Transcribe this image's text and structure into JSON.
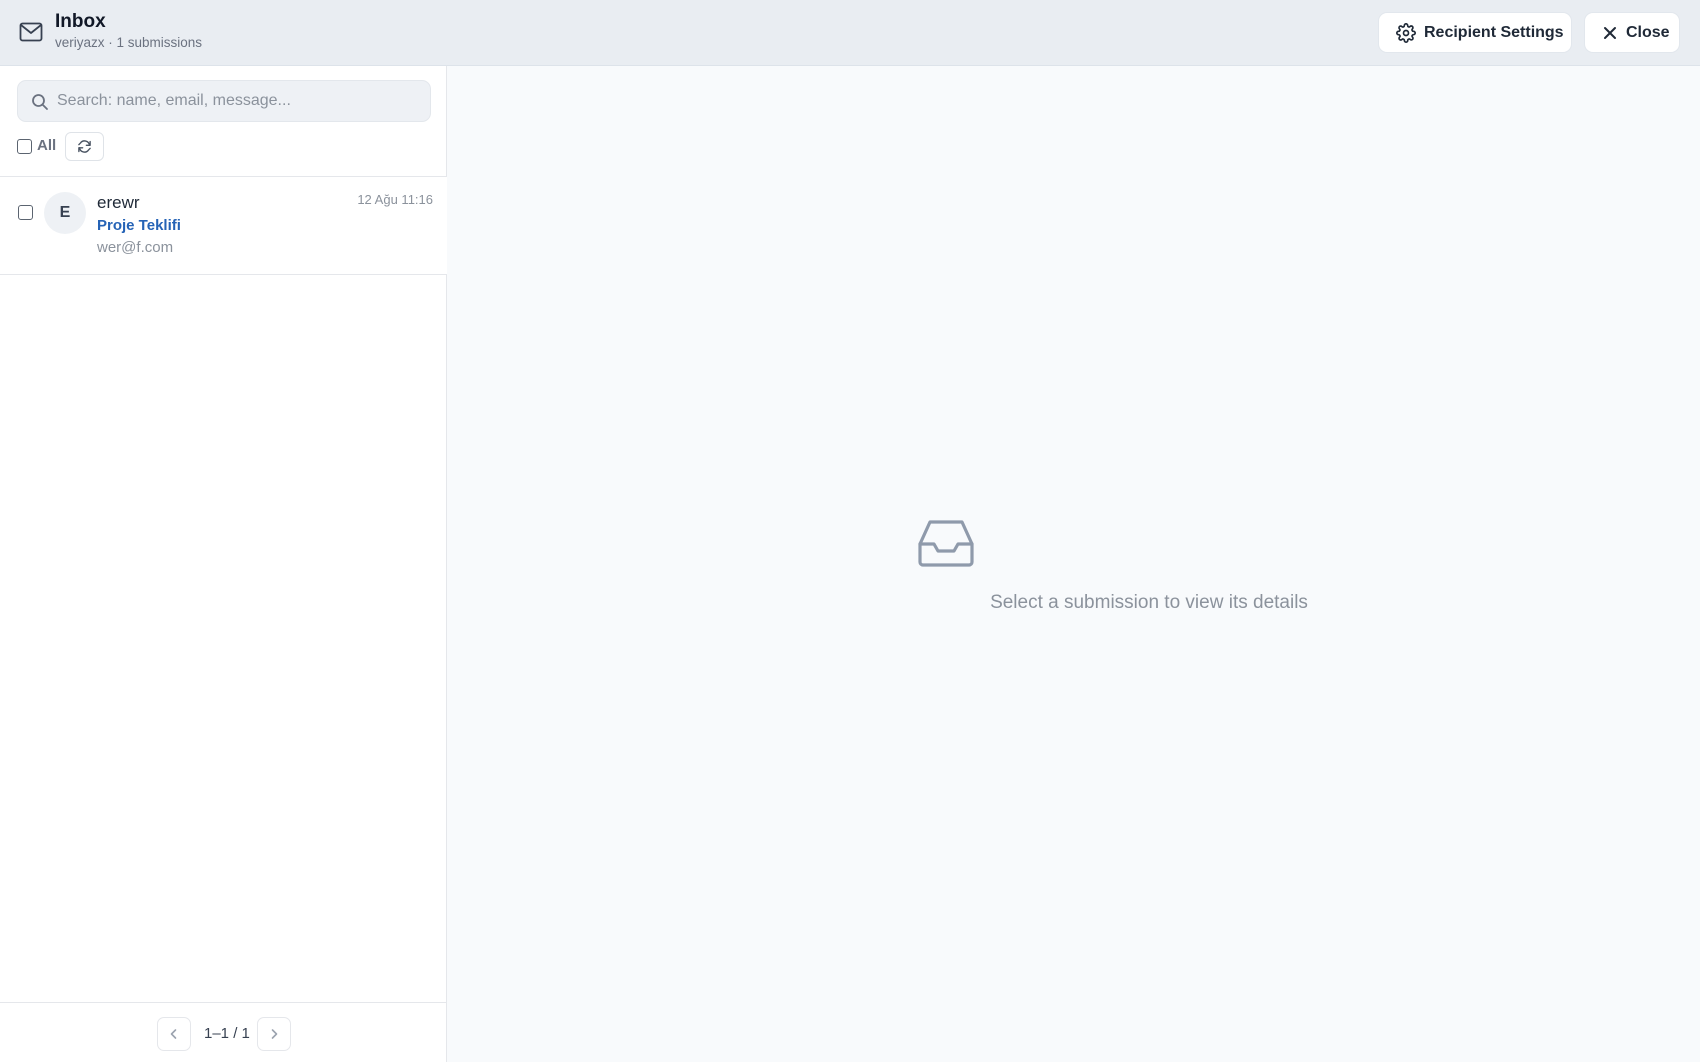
{
  "header": {
    "title": "Inbox",
    "subtitle": "veriyazx · 1 submissions",
    "settings_label": "Recipient Settings",
    "close_label": "Close"
  },
  "sidebar": {
    "search_placeholder": "Search: name, email, message...",
    "select_all_label": "All",
    "items": [
      {
        "avatar": "E",
        "name": "erewr",
        "subject": "Proje Teklifi",
        "email": "wer@f.com",
        "time": "12 Ağu 11:16"
      }
    ],
    "pagination": "1–1 / 1"
  },
  "detail": {
    "empty_message": "Select a submission to view its details"
  },
  "colors": {
    "accent": "#2563b6",
    "header_bg": "#e9edf2"
  }
}
